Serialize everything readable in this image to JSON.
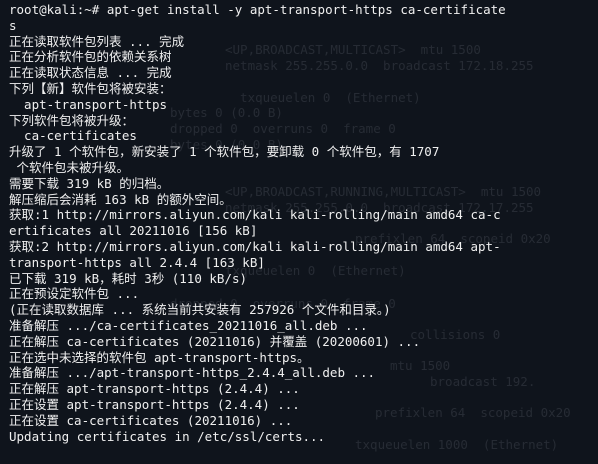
{
  "terminal": {
    "lines": [
      "root@kali:~# apt-get install -y apt-transport-https ca-certificate",
      "s",
      "正在读取软件包列表 ... 完成",
      "正在分析软件包的依赖关系树",
      "正在读取状态信息 ... 完成",
      "下列【新】软件包将被安装：",
      "  apt-transport-https",
      "下列软件包将被升级：",
      "  ca-certificates",
      "升级了 1 个软件包，新安装了 1 个软件包，要卸载 0 个软件包，有 1707",
      " 个软件包未被升级。",
      "需要下载 319 kB 的归档。",
      "解压缩后会消耗 163 kB 的额外空间。",
      "获取:1 http://mirrors.aliyun.com/kali kali-rolling/main amd64 ca-c",
      "ertificates all 20211016 [156 kB]",
      "获取:2 http://mirrors.aliyun.com/kali kali-rolling/main amd64 apt-",
      "transport-https all 2.4.4 [163 kB]",
      "已下载 319 kB，耗时 3秒 (110 kB/s)",
      "正在预设定软件包 ...",
      "(正在读取数据库 ... 系统当前共安装有 257926 个文件和目录。)",
      "准备解压 .../ca-certificates_20211016_all.deb ...",
      "正在解压 ca-certificates (20211016) 并覆盖 (20200601) ...",
      "正在选中未选择的软件包 apt-transport-https。",
      "准备解压 .../apt-transport-https_2.4.4_all.deb ...",
      "正在解压 apt-transport-https (2.4.4) ...",
      "正在设置 apt-transport-https (2.4.4) ...",
      "正在设置 ca-certificates (20211016) ...",
      "Updating certificates in /etc/ssl/certs..."
    ],
    "ghost_lines": [
      "<UP,BROADCAST,MULTICAST>  mtu 1500",
      "netmask 255.255.0.0  broadcast 172.18.255",
      "  txqueuelen 0  (Ethernet)",
      "bytes 0 (0.0 B)",
      "dropped 0  overruns 0  frame 0",
      "bytes 0 (0.0 B)",
      "<UP,BROADCAST,RUNNING,MULTICAST>  mtu 1500",
      "netmask 255.255.0.0  broadcast 172.17.255",
      "prefixlen 64  scopeid 0x20",
      "txqueuelen 0  (Ethernet)",
      "dropped 0  overruns 0  frame 0",
      "collisions 0",
      "mtu 1500",
      "broadcast 192.",
      "prefixlen 64  scopeid 0x20",
      "txqueuelen 1000  (Ethernet)"
    ]
  }
}
